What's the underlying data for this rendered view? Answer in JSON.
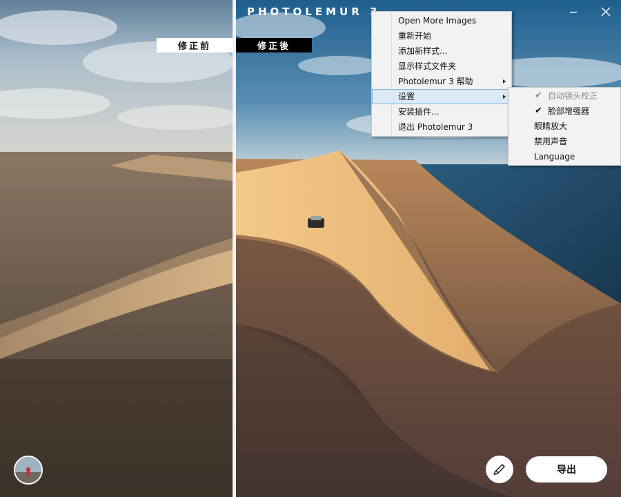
{
  "app": {
    "title": "PHOTOLEMUR 3"
  },
  "compare": {
    "before_label": "修正前",
    "after_label": "修正後"
  },
  "main_menu": {
    "items": [
      {
        "label": "Open More Images",
        "submenu": false,
        "highlighted": false
      },
      {
        "label": "重新开始",
        "submenu": false,
        "highlighted": false
      },
      {
        "label": "添加新样式...",
        "submenu": false,
        "highlighted": false
      },
      {
        "label": "显示样式文件夹",
        "submenu": false,
        "highlighted": false
      },
      {
        "label": "Photolemur 3 帮助",
        "submenu": true,
        "highlighted": false
      },
      {
        "label": "设置",
        "submenu": true,
        "highlighted": true
      },
      {
        "label": "安装插件...",
        "submenu": false,
        "highlighted": false
      },
      {
        "label": "退出 Photolemur 3",
        "submenu": false,
        "highlighted": false
      }
    ]
  },
  "settings_menu": {
    "items": [
      {
        "label": "自动镜头校正",
        "checked": true,
        "disabled": true
      },
      {
        "label": "脸部增强器",
        "checked": true,
        "disabled": false
      },
      {
        "label": "眼睛放大",
        "checked": false,
        "disabled": false
      },
      {
        "label": "禁用声音",
        "checked": false,
        "disabled": false
      },
      {
        "label": "Language",
        "checked": false,
        "disabled": false
      }
    ]
  },
  "toolbar": {
    "export_label": "导出"
  },
  "icons": {
    "minimize": "minimize-icon",
    "close": "close-icon",
    "brush": "brush-icon",
    "check": "checkmark-icon",
    "arrow": "submenu-arrow-icon"
  },
  "colors": {
    "menu_bg": "#f2f2f2",
    "menu_highlight": "#dceaf6",
    "menu_highlight_border": "#7fb3e0",
    "label_before_bg": "#ffffff",
    "label_after_bg": "#000000"
  }
}
